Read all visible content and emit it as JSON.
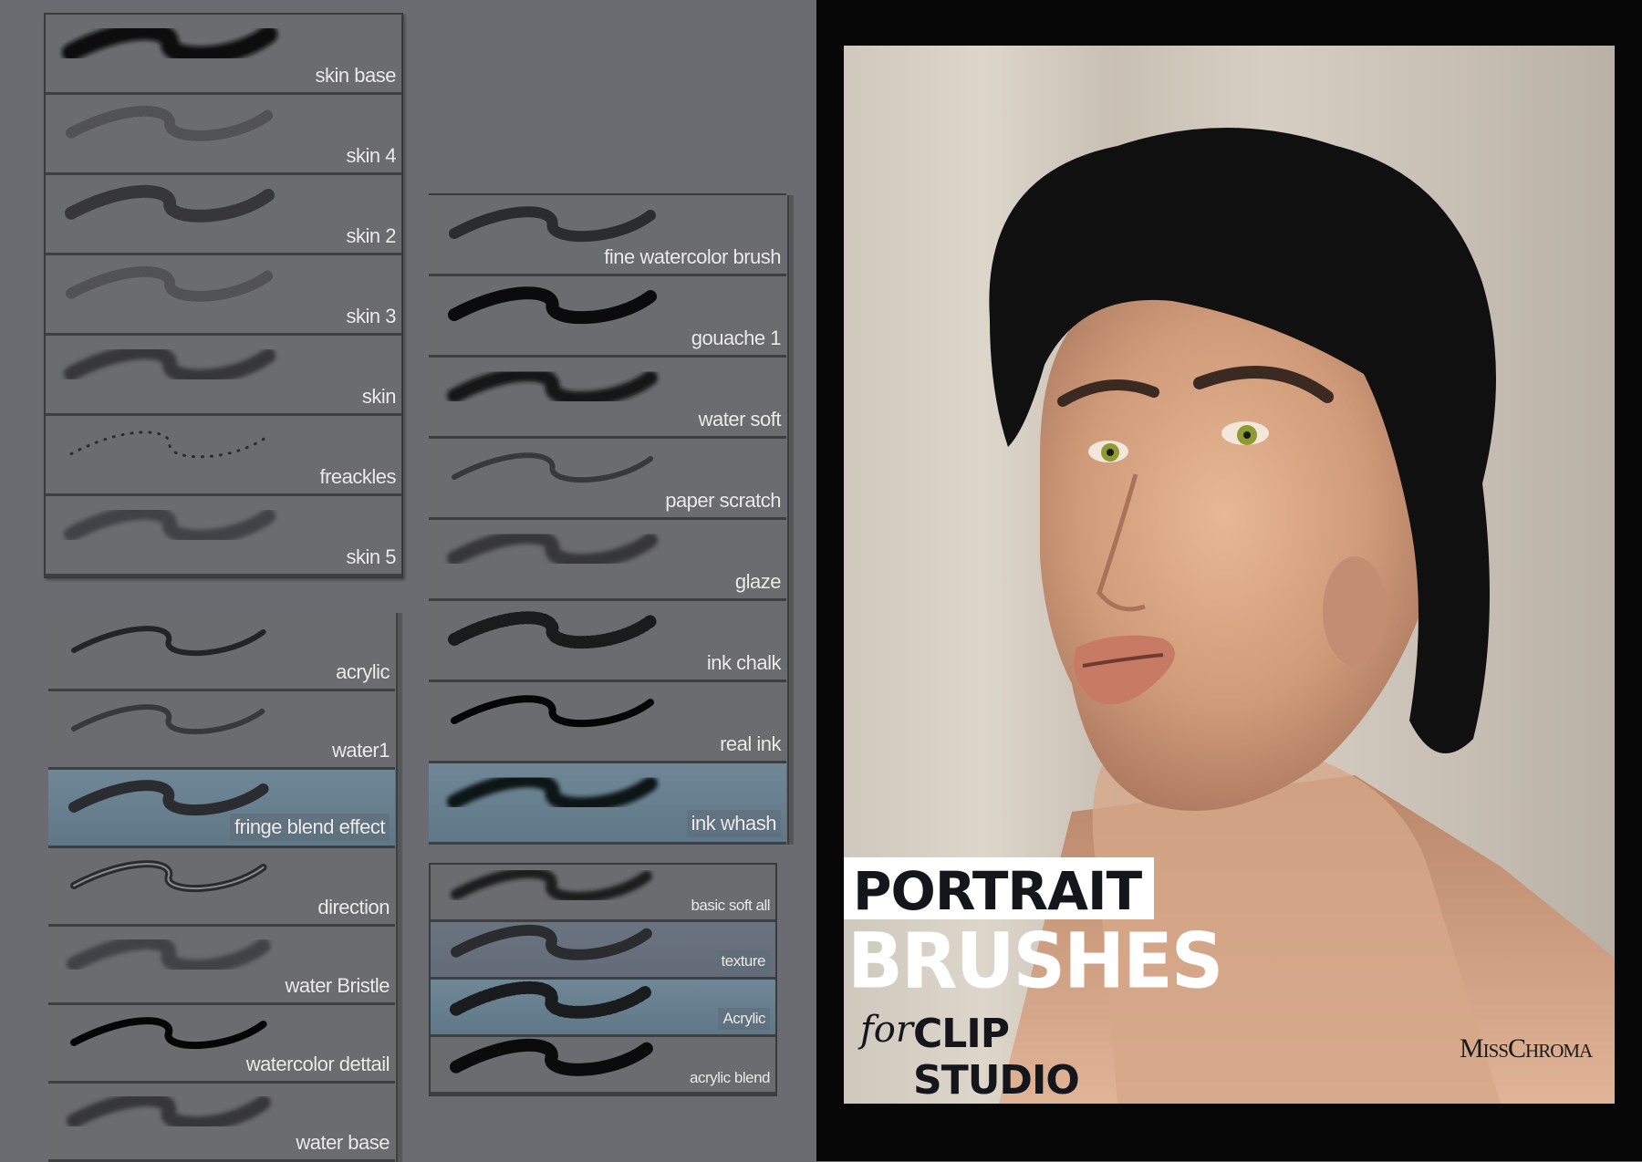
{
  "brush_panels": [
    {
      "id": "skin-set",
      "brushes": [
        {
          "label": "skin base",
          "style": "solid-soft"
        },
        {
          "label": "skin 4",
          "style": "faint-speckle"
        },
        {
          "label": "skin 2",
          "style": "speckle"
        },
        {
          "label": "skin 3",
          "style": "faint-speckle"
        },
        {
          "label": "skin",
          "style": "soft-grain"
        },
        {
          "label": "freackles",
          "style": "dots"
        },
        {
          "label": "skin 5",
          "style": "soft-mid"
        }
      ]
    },
    {
      "id": "paint-set",
      "brushes": [
        {
          "label": "fine watercolor brush",
          "style": "rough"
        },
        {
          "label": "gouache 1",
          "style": "solid-rough"
        },
        {
          "label": "water soft",
          "style": "gradient"
        },
        {
          "label": "paper scratch",
          "style": "thin-grain"
        },
        {
          "label": "glaze",
          "style": "soft-grain"
        },
        {
          "label": "ink chalk",
          "style": "chalk"
        },
        {
          "label": "real ink",
          "style": "ink"
        },
        {
          "label": "ink whash",
          "style": "wash",
          "selected": true
        }
      ]
    },
    {
      "id": "acrylic-set",
      "brushes": [
        {
          "label": "acrylic",
          "style": "thin"
        },
        {
          "label": "water1",
          "style": "thin-grain"
        },
        {
          "label": "fringe blend effect",
          "style": "rough",
          "selected": true
        },
        {
          "label": "direction",
          "style": "bristle"
        },
        {
          "label": "water  Bristle",
          "style": "soft-mid"
        },
        {
          "label": "watercolor dettail",
          "style": "ink"
        },
        {
          "label": "water base",
          "style": "soft-grain"
        }
      ]
    },
    {
      "id": "texture-set",
      "brushes": [
        {
          "label": "basic soft all",
          "style": "airbrush"
        },
        {
          "label": "texture",
          "style": "rough",
          "selected_dim": true
        },
        {
          "label": "Acrylic",
          "style": "chalk",
          "selected": true
        },
        {
          "label": "acrylic blend",
          "style": "solid-rough"
        }
      ]
    }
  ],
  "artwork": {
    "title_line1": "PORTRAIT",
    "title_line2": "BRUSHES",
    "title_for": "for",
    "title_line3": "CLIP STUDIO",
    "signature": "MissChroma"
  },
  "colors": {
    "panel_bg": "#6b6c70",
    "selected_row": "#6f8796",
    "label_text": "#ececec",
    "border": "#3e3f43"
  }
}
